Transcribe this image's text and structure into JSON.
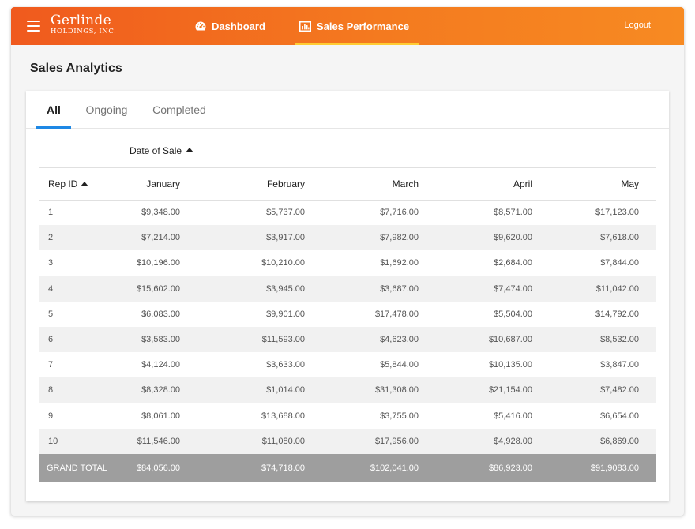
{
  "header": {
    "logo_line1": "Gerlinde",
    "logo_line2": "HOLDINGS, INC.",
    "nav": [
      {
        "label": "Dashboard",
        "icon": "gauge-icon"
      },
      {
        "label": "Sales Performance",
        "icon": "bar-chart-icon"
      }
    ],
    "active_nav": "Sales Performance",
    "logout_label": "Logout",
    "colors": {
      "bar_start": "#f05a1e",
      "bar_end": "#f78a22",
      "active_underline": "#ffcc33"
    }
  },
  "page": {
    "title": "Sales Analytics"
  },
  "tabs": {
    "items": [
      "All",
      "Ongoing",
      "Completed"
    ],
    "active": "All",
    "ink_color": "#1e88e5"
  },
  "table": {
    "group_label": "Date of Sale",
    "rep_header": "Rep ID",
    "months": [
      "January",
      "February",
      "March",
      "April",
      "May"
    ],
    "rows": [
      {
        "rep": "1",
        "values": [
          "$9,348.00",
          "$5,737.00",
          "$7,716.00",
          "$8,571.00",
          "$17,123.00"
        ]
      },
      {
        "rep": "2",
        "values": [
          "$7,214.00",
          "$3,917.00",
          "$7,982.00",
          "$9,620.00",
          "$7,618.00"
        ]
      },
      {
        "rep": "3",
        "values": [
          "$10,196.00",
          "$10,210.00",
          "$1,692.00",
          "$2,684.00",
          "$7,844.00"
        ]
      },
      {
        "rep": "4",
        "values": [
          "$15,602.00",
          "$3,945.00",
          "$3,687.00",
          "$7,474.00",
          "$11,042.00"
        ]
      },
      {
        "rep": "5",
        "values": [
          "$6,083.00",
          "$9,901.00",
          "$17,478.00",
          "$5,504.00",
          "$14,792.00"
        ]
      },
      {
        "rep": "6",
        "values": [
          "$3,583.00",
          "$11,593.00",
          "$4,623.00",
          "$10,687.00",
          "$8,532.00"
        ]
      },
      {
        "rep": "7",
        "values": [
          "$4,124.00",
          "$3,633.00",
          "$5,844.00",
          "$10,135.00",
          "$3,847.00"
        ]
      },
      {
        "rep": "8",
        "values": [
          "$8,328.00",
          "$1,014.00",
          "$31,308.00",
          "$21,154.00",
          "$7,482.00"
        ]
      },
      {
        "rep": "9",
        "values": [
          "$8,061.00",
          "$13,688.00",
          "$3,755.00",
          "$5,416.00",
          "$6,654.00"
        ]
      },
      {
        "rep": "10",
        "values": [
          "$11,546.00",
          "$11,080.00",
          "$17,956.00",
          "$4,928.00",
          "$6,869.00"
        ]
      }
    ],
    "total": {
      "label": "GRAND TOTAL",
      "values": [
        "$84,056.00",
        "$74,718.00",
        "$102,041.00",
        "$86,923.00",
        "$91,9083.00"
      ]
    }
  }
}
